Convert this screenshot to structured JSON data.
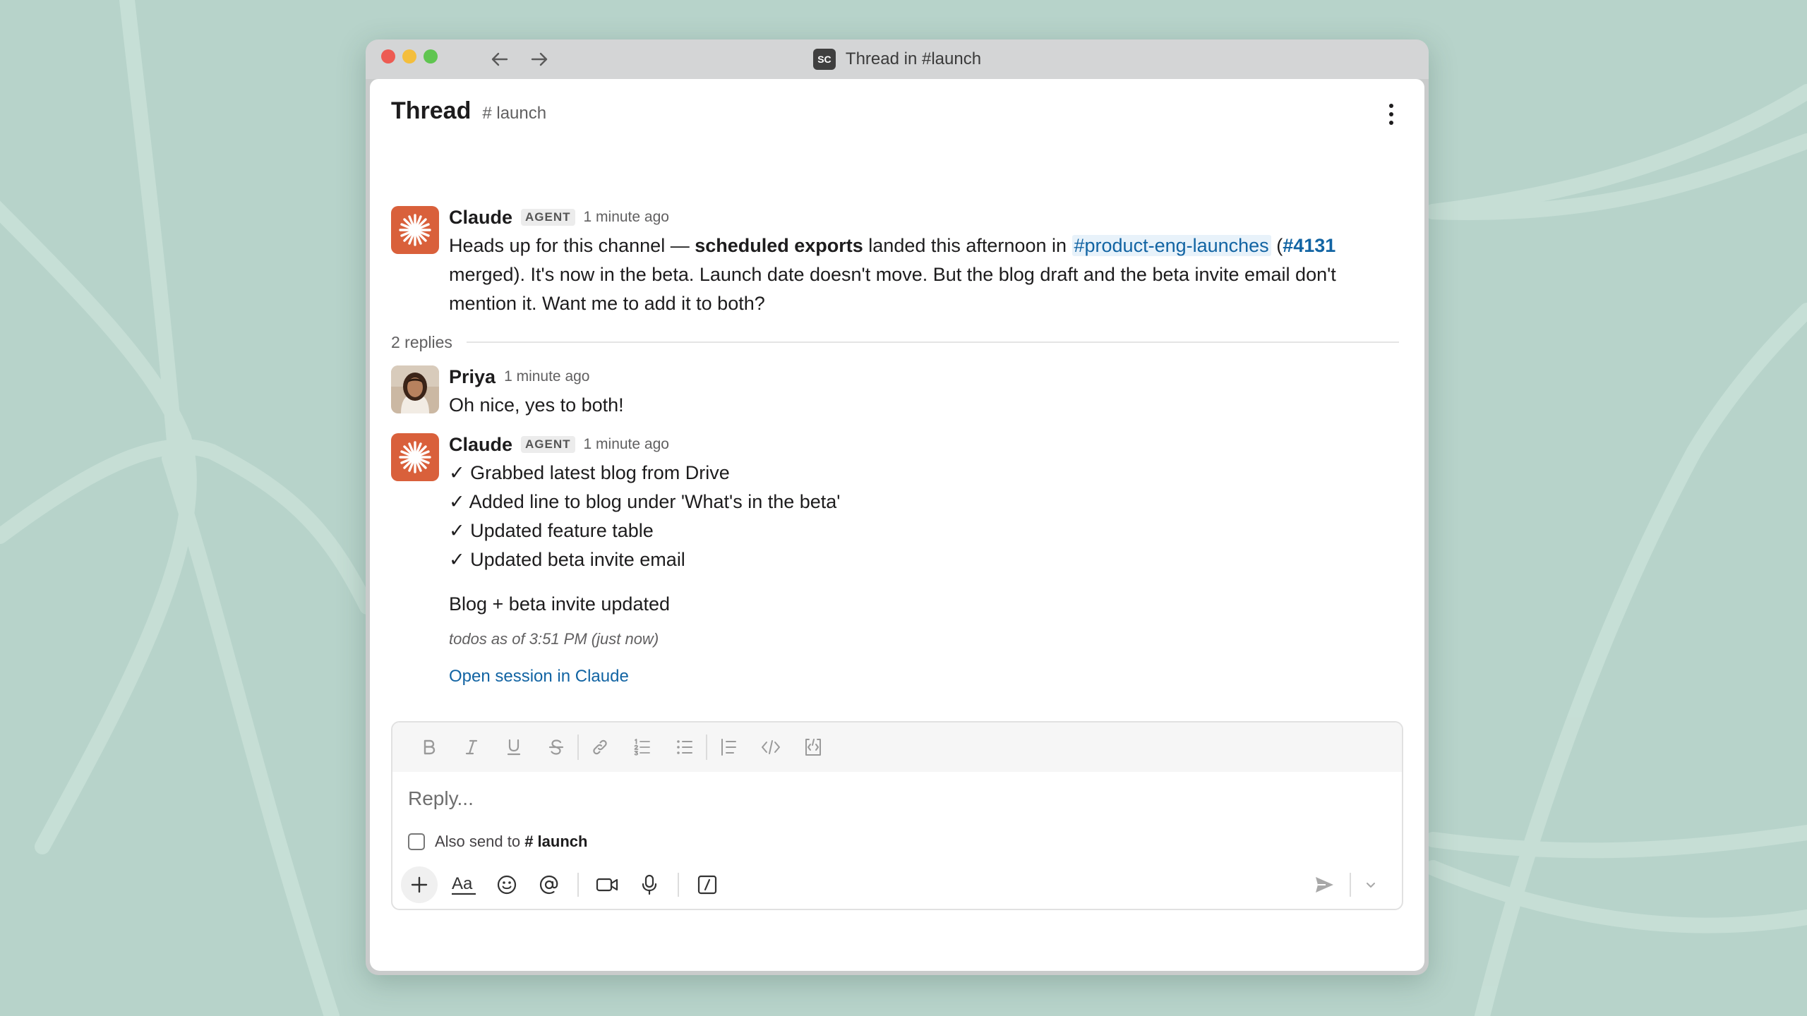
{
  "window": {
    "title": "Thread in #launch",
    "workspace_badge": "SC"
  },
  "thread": {
    "title": "Thread",
    "channel": "# launch"
  },
  "messages": [
    {
      "author": "Claude",
      "badge": "AGENT",
      "time": "1 minute ago",
      "text_before": "Heads up for this channel — ",
      "text_bold": "scheduled exports",
      "text_middle": " landed this afternoon in ",
      "channel_link": "#product-eng-launches",
      "paren_open": " (",
      "pr_link": "#4131",
      "text_after": " merged). It's now in the beta. Launch date doesn't move. But the blog draft and the beta invite email don't mention it. Want me to add it to both?"
    },
    {
      "author": "Priya",
      "time": "1 minute ago",
      "text": "Oh nice, yes to both!"
    },
    {
      "author": "Claude",
      "badge": "AGENT",
      "time": "1 minute ago",
      "checklist": [
        "✓ Grabbed latest blog from Drive",
        "✓ Added line to blog under 'What's in the beta'",
        "✓ Updated feature table",
        "✓ Updated beta invite email"
      ],
      "summary": "Blog + beta invite updated",
      "todos_note": "todos as of 3:51 PM (just now)",
      "open_link": "Open session in Claude"
    }
  ],
  "replies": {
    "count_label": "2 replies"
  },
  "composer": {
    "placeholder": "Reply...",
    "also_send_prefix": "Also send to ",
    "also_send_channel": "# launch"
  },
  "colors": {
    "background": "#b7d3ca",
    "claude_avatar": "#d9603b",
    "link": "#1264a3"
  },
  "icons": {
    "format": [
      "bold-icon",
      "italic-icon",
      "underline-icon",
      "strikethrough-icon",
      "link-icon",
      "numbered-list-icon",
      "bulleted-list-icon",
      "blockquote-icon",
      "code-icon",
      "code-block-icon"
    ],
    "tools": [
      "plus-icon",
      "text-format-icon",
      "emoji-icon",
      "mention-icon",
      "video-icon",
      "microphone-icon",
      "slash-command-icon",
      "send-icon",
      "chevron-down-icon"
    ]
  }
}
